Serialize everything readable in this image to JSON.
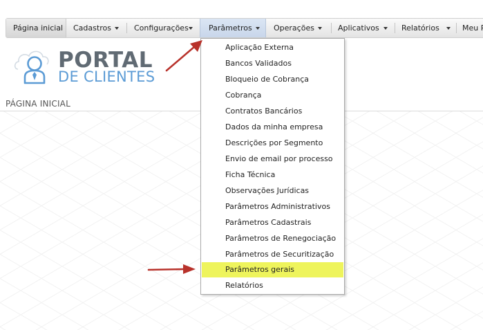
{
  "menu": {
    "items": [
      {
        "label": "Página inicial"
      },
      {
        "label": "Cadastros"
      },
      {
        "label": "Configurações"
      },
      {
        "label": "Parâmetros"
      },
      {
        "label": "Operações"
      },
      {
        "label": "Aplicativos"
      },
      {
        "label": "Relatórios"
      },
      {
        "label": "Meu P"
      }
    ]
  },
  "logo": {
    "title": "PORTAL",
    "subtitle": "DE CLIENTES",
    "title_color": "#606a73",
    "subtitle_color": "#5b9bd5"
  },
  "page": {
    "title": "PÁGINA INICIAL"
  },
  "dropdown": {
    "items": [
      {
        "label": "Aplicação Externa"
      },
      {
        "label": "Bancos Validados"
      },
      {
        "label": "Bloqueio de Cobrança"
      },
      {
        "label": "Cobrança"
      },
      {
        "label": "Contratos Bancários"
      },
      {
        "label": "Dados da minha empresa"
      },
      {
        "label": "Descrições por Segmento"
      },
      {
        "label": "Envio de email por processo"
      },
      {
        "label": "Ficha Técnica"
      },
      {
        "label": "Observações Jurídicas"
      },
      {
        "label": "Parâmetros Administrativos"
      },
      {
        "label": "Parâmetros Cadastrais"
      },
      {
        "label": "Parâmetros de Renegociação"
      },
      {
        "label": "Parâmetros de Securitização"
      },
      {
        "label": "Parâmetros gerais"
      },
      {
        "label": "Relatórios"
      }
    ],
    "highlighted": "Parâmetros gerais",
    "highlight_color": "#eef45c"
  },
  "annotations": {
    "arrow_color": "#c0392b"
  }
}
